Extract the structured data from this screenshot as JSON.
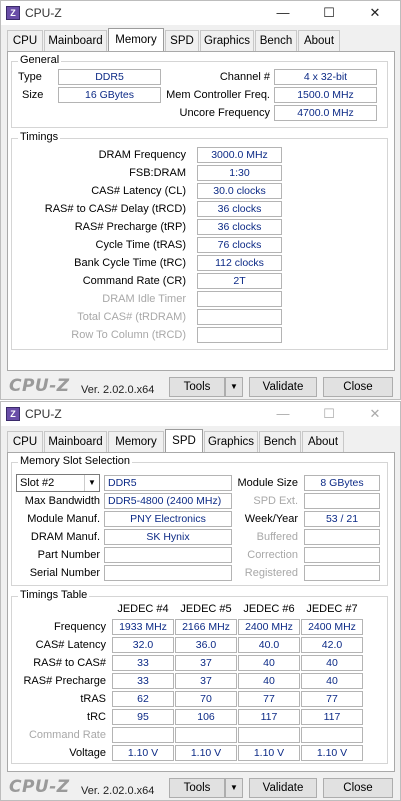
{
  "window1": {
    "title": "CPU-Z",
    "tabs": [
      "CPU",
      "Mainboard",
      "Memory",
      "SPD",
      "Graphics",
      "Bench",
      "About"
    ],
    "active_tab": "Memory",
    "general": {
      "title": "General",
      "type_label": "Type",
      "type_value": "DDR5",
      "size_label": "Size",
      "size_value": "16 GBytes",
      "channel_label": "Channel #",
      "channel_value": "4 x 32-bit",
      "mcfreq_label": "Mem Controller Freq.",
      "mcfreq_value": "1500.0 MHz",
      "uncore_label": "Uncore Frequency",
      "uncore_value": "4700.0 MHz"
    },
    "timings": {
      "title": "Timings",
      "rows": [
        {
          "label": "DRAM Frequency",
          "value": "3000.0 MHz"
        },
        {
          "label": "FSB:DRAM",
          "value": "1:30"
        },
        {
          "label": "CAS# Latency (CL)",
          "value": "30.0 clocks"
        },
        {
          "label": "RAS# to CAS# Delay (tRCD)",
          "value": "36 clocks"
        },
        {
          "label": "RAS# Precharge (tRP)",
          "value": "36 clocks"
        },
        {
          "label": "Cycle Time (tRAS)",
          "value": "76 clocks"
        },
        {
          "label": "Bank Cycle Time (tRC)",
          "value": "112 clocks"
        },
        {
          "label": "Command Rate (CR)",
          "value": "2T"
        },
        {
          "label": "DRAM Idle Timer",
          "value": ""
        },
        {
          "label": "Total CAS# (tRDRAM)",
          "value": ""
        },
        {
          "label": "Row To Column (tRCD)",
          "value": ""
        }
      ]
    },
    "footer": {
      "logo": "CPU-Z",
      "version": "Ver. 2.02.0.x64",
      "tools": "Tools",
      "validate": "Validate",
      "close": "Close"
    }
  },
  "window2": {
    "title": "CPU-Z",
    "tabs": [
      "CPU",
      "Mainboard",
      "Memory",
      "SPD",
      "Graphics",
      "Bench",
      "About"
    ],
    "active_tab": "SPD",
    "slot": {
      "title": "Memory Slot Selection",
      "selected": "Slot #2",
      "type_value": "DDR5",
      "module_size_label": "Module Size",
      "module_size_value": "8 GBytes",
      "max_bw_label": "Max Bandwidth",
      "max_bw_value": "DDR5-4800 (2400 MHz)",
      "spd_ext_label": "SPD Ext.",
      "spd_ext_value": "",
      "manuf_label": "Module Manuf.",
      "manuf_value": "PNY Electronics",
      "week_label": "Week/Year",
      "week_value": "53 / 21",
      "dram_manuf_label": "DRAM Manuf.",
      "dram_manuf_value": "SK Hynix",
      "buffered_label": "Buffered",
      "buffered_value": "",
      "part_label": "Part Number",
      "part_value": "",
      "correction_label": "Correction",
      "correction_value": "",
      "serial_label": "Serial Number",
      "serial_value": "",
      "registered_label": "Registered",
      "registered_value": ""
    },
    "timings_table": {
      "title": "Timings Table",
      "columns": [
        "JEDEC #4",
        "JEDEC #5",
        "JEDEC #6",
        "JEDEC #7"
      ],
      "rows": [
        {
          "label": "Frequency",
          "values": [
            "1933 MHz",
            "2166 MHz",
            "2400 MHz",
            "2400 MHz"
          ]
        },
        {
          "label": "CAS# Latency",
          "values": [
            "32.0",
            "36.0",
            "40.0",
            "42.0"
          ]
        },
        {
          "label": "RAS# to CAS#",
          "values": [
            "33",
            "37",
            "40",
            "40"
          ]
        },
        {
          "label": "RAS# Precharge",
          "values": [
            "33",
            "37",
            "40",
            "40"
          ]
        },
        {
          "label": "tRAS",
          "values": [
            "62",
            "70",
            "77",
            "77"
          ]
        },
        {
          "label": "tRC",
          "values": [
            "95",
            "106",
            "117",
            "117"
          ]
        },
        {
          "label": "Command Rate",
          "values": [
            "",
            "",
            "",
            ""
          ]
        },
        {
          "label": "Voltage",
          "values": [
            "1.10 V",
            "1.10 V",
            "1.10 V",
            "1.10 V"
          ]
        }
      ]
    },
    "footer": {
      "logo": "CPU-Z",
      "version": "Ver. 2.02.0.x64",
      "tools": "Tools",
      "validate": "Validate",
      "close": "Close"
    }
  },
  "icons": {
    "minimize": "—",
    "maximize": "☐",
    "close": "✕",
    "dropdown": "▼"
  },
  "colors": {
    "value_text": "#0c2a86",
    "disabled_text": "#a8a8a8"
  }
}
